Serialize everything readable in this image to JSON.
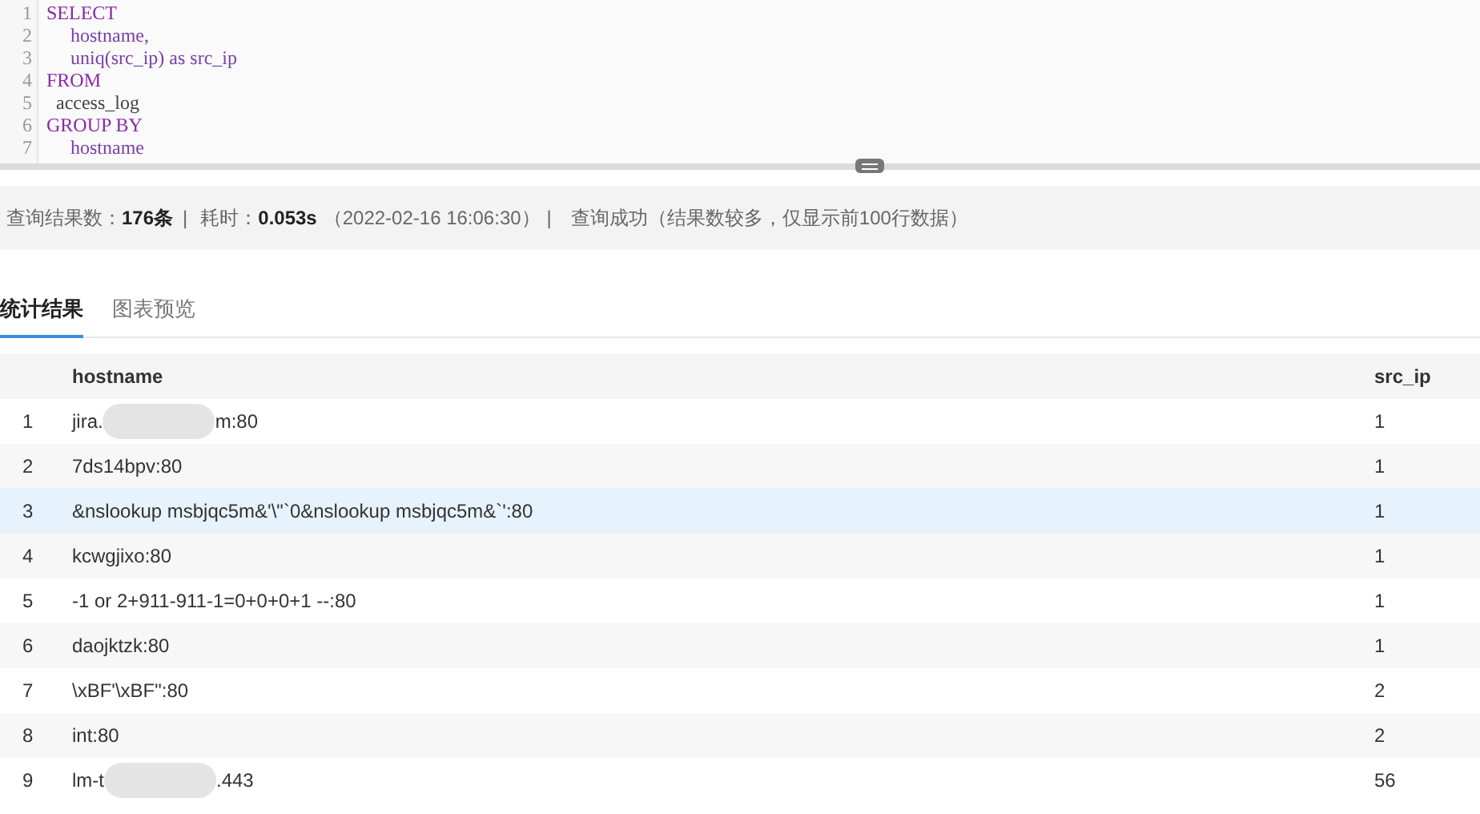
{
  "editor": {
    "lines": [
      [
        {
          "kind": "keyword",
          "text": "SELECT"
        }
      ],
      [
        {
          "kind": "indent"
        },
        {
          "kind": "ident",
          "text": "hostname,"
        }
      ],
      [
        {
          "kind": "indent"
        },
        {
          "kind": "ident",
          "text": "uniq(src_ip) as src_ip"
        }
      ],
      [
        {
          "kind": "keyword",
          "text": "FROM"
        }
      ],
      [
        {
          "kind": "plain",
          "text": "  access_log"
        }
      ],
      [
        {
          "kind": "keyword",
          "text": "GROUP BY"
        }
      ],
      [
        {
          "kind": "indent"
        },
        {
          "kind": "ident",
          "text": "hostname"
        }
      ]
    ],
    "line_numbers": [
      "1",
      "2",
      "3",
      "4",
      "5",
      "6",
      "7"
    ]
  },
  "status_bar": {
    "count_label": "查询结果数：",
    "count": "176条",
    "sep1": "|",
    "time_label": "耗时：",
    "time": "0.053s",
    "timestamp": "（2022-02-16 16:06:30）",
    "sep2": "|",
    "message": "查询成功（结果数较多，仅显示前100行数据）"
  },
  "tabs": [
    {
      "label": "统计结果",
      "selected": true
    },
    {
      "label": "图表预览",
      "selected": false
    }
  ],
  "table": {
    "columns": [
      "hostname",
      "src_ip"
    ],
    "rows": [
      {
        "index": "1",
        "hostname": [
          "jira.",
          "m:80"
        ],
        "src_ip": "1",
        "selected": false
      },
      {
        "index": "2",
        "hostname": [
          "7ds14bpv:80"
        ],
        "src_ip": "1",
        "selected": false
      },
      {
        "index": "3",
        "hostname": [
          "&nslookup msbjqc5m&'\\\"`0&nslookup msbjqc5m&`':80"
        ],
        "src_ip": "1",
        "selected": true
      },
      {
        "index": "4",
        "hostname": [
          "kcwgjixo:80"
        ],
        "src_ip": "1",
        "selected": false
      },
      {
        "index": "5",
        "hostname": [
          "-1 or 2+911-911-1=0+0+0+1 --:80"
        ],
        "src_ip": "1",
        "selected": false
      },
      {
        "index": "6",
        "hostname": [
          "daojktzk:80"
        ],
        "src_ip": "1",
        "selected": false
      },
      {
        "index": "7",
        "hostname": [
          "\\xBF'\\xBF\":80"
        ],
        "src_ip": "2",
        "selected": false
      },
      {
        "index": "8",
        "hostname": [
          "int:80"
        ],
        "src_ip": "2",
        "selected": false
      },
      {
        "index": "9",
        "hostname": [
          "lm-t",
          ".443"
        ],
        "src_ip": "56",
        "selected": false
      }
    ]
  }
}
